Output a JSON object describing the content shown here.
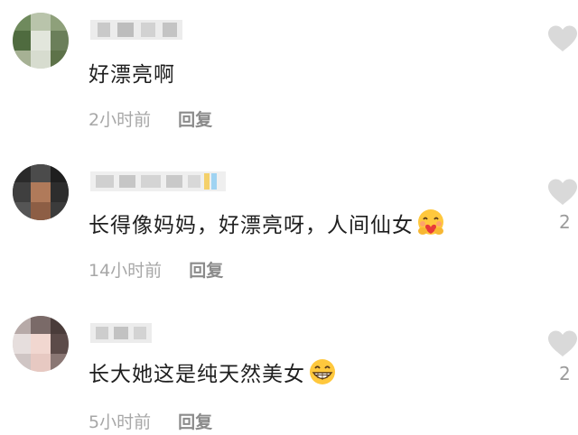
{
  "comments": [
    {
      "text": "好漂亮啊",
      "time": "2小时前",
      "reply_label": "回复",
      "like_count": ""
    },
    {
      "text": "长得像妈妈，好漂亮呀，人间仙女",
      "emoji": "hugging-face-emoji",
      "time": "14小时前",
      "reply_label": "回复",
      "like_count": "2"
    },
    {
      "text": "长大她这是纯天然美女",
      "emoji": "grinning-face-emoji",
      "time": "5小时前",
      "reply_label": "回复",
      "like_count": "2"
    }
  ],
  "colors": {
    "text": "#1f1f1f",
    "meta": "#a7a7a7",
    "heart": "#d9d9d9"
  }
}
